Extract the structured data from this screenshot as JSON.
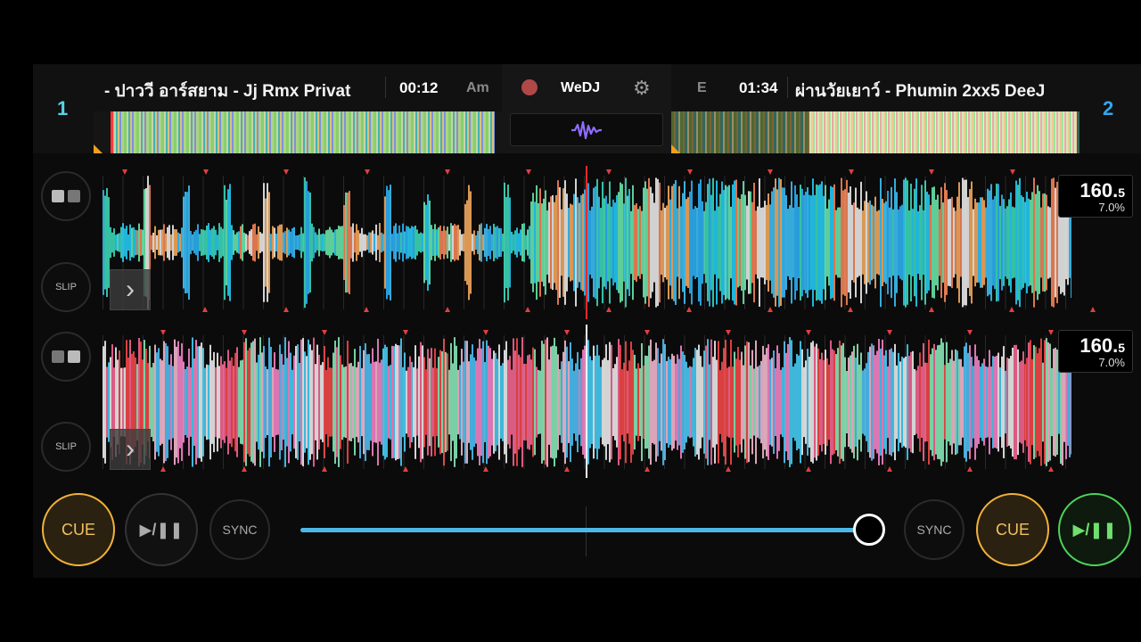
{
  "deck1": {
    "number": "1",
    "title": "- ปาววี อาร์สยาม - Jj Rmx Privat",
    "time": "00:12",
    "key": "Am",
    "bpm": "160.",
    "bpm_decimal": "5",
    "pitch": "7.0%",
    "slip_label": "SLIP",
    "cue_label": "CUE",
    "play_label": "▶/❚❚",
    "sync_label": "SYNC"
  },
  "deck2": {
    "number": "2",
    "title": "ผ่านวัยเยาว์ - Phumin 2xx5 DeeJ",
    "time": "01:34",
    "key": "E",
    "bpm": "160.",
    "bpm_decimal": "5",
    "pitch": "7.0%",
    "slip_label": "SLIP",
    "cue_label": "CUE",
    "play_label": "▶/❚❚",
    "sync_label": "SYNC"
  },
  "center": {
    "brand": "WeDJ",
    "gear_icon": "⚙"
  },
  "crossfader": {
    "position": 0.99
  },
  "colors": {
    "accent_cue": "#f2b13a",
    "accent_play": "#4fd25a",
    "crossfader": "#4db8e6",
    "deck1_number": "#58d3e6",
    "deck2_number": "#35a6ec"
  }
}
